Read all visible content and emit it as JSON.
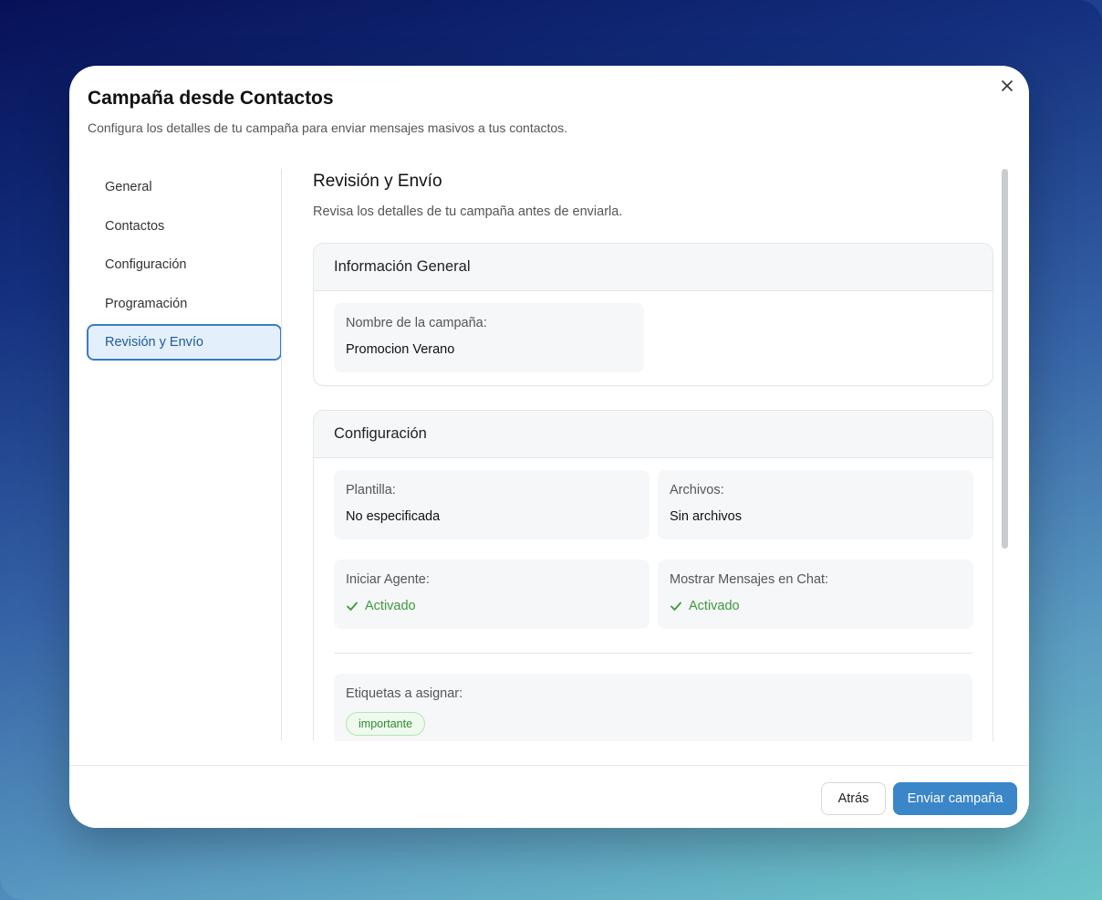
{
  "modal": {
    "title": "Campaña desde Contactos",
    "subtitle": "Configura los detalles de tu campaña para enviar mensajes masivos a tus contactos."
  },
  "sidebar": {
    "items": [
      {
        "label": "General"
      },
      {
        "label": "Contactos"
      },
      {
        "label": "Configuración"
      },
      {
        "label": "Programación"
      },
      {
        "label": "Revisión y Envío",
        "active": true
      }
    ]
  },
  "review": {
    "title": "Revisión y Envío",
    "subtitle": "Revisa los detalles de tu campaña antes de enviarla.",
    "general": {
      "header": "Información General",
      "name_label": "Nombre de la campaña:",
      "name_value": "Promocion Verano"
    },
    "config": {
      "header": "Configuración",
      "template_label": "Plantilla:",
      "template_value": "No especificada",
      "files_label": "Archivos:",
      "files_value": "Sin archivos",
      "agent_label": "Iniciar Agente:",
      "agent_value": "Activado",
      "show_msgs_label": "Mostrar Mensajes en Chat:",
      "show_msgs_value": "Activado",
      "tags_label": "Etiquetas a asignar:",
      "tags": [
        "importante"
      ]
    }
  },
  "footer": {
    "back_label": "Atrás",
    "send_label": "Enviar campaña"
  },
  "colors": {
    "accent": "#3a86c8",
    "active_bg": "#e3f0fc",
    "success": "#3b9a3b"
  }
}
